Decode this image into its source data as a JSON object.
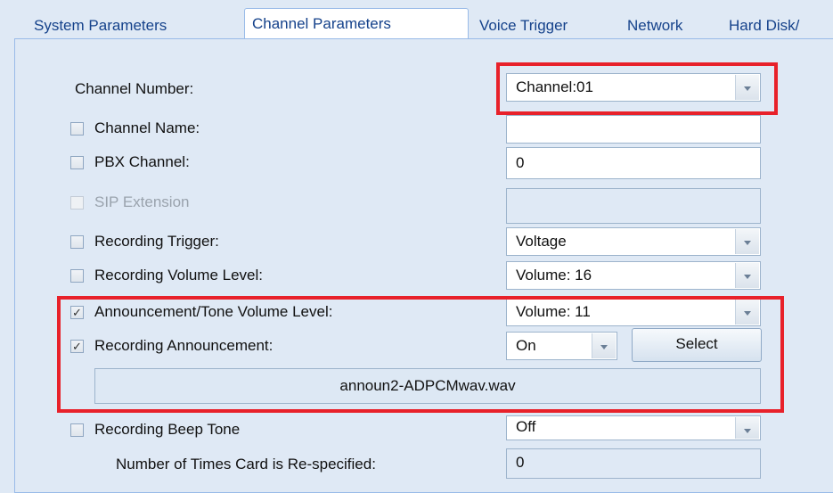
{
  "tabs": [
    {
      "label": "System Parameters"
    },
    {
      "label": "Channel Parameters"
    },
    {
      "label": "Voice Trigger"
    },
    {
      "label": "Network"
    },
    {
      "label": "Hard Disk/"
    }
  ],
  "form": {
    "channel_number": {
      "label": "Channel Number:",
      "value": "Channel:01"
    },
    "channel_name": {
      "label": "Channel Name:",
      "value": "",
      "checked": false
    },
    "pbx_channel": {
      "label": "PBX Channel:",
      "value": "0",
      "checked": false
    },
    "sip_extension": {
      "label": "SIP Extension",
      "value": "",
      "checked": false,
      "disabled": true
    },
    "recording_trigger": {
      "label": "Recording Trigger:",
      "value": "Voltage",
      "checked": false
    },
    "recording_volume": {
      "label": "Recording Volume Level:",
      "value": "Volume: 16",
      "checked": false
    },
    "announcement_volume": {
      "label": "Announcement/Tone Volume Level:",
      "value": "Volume: 11",
      "checked": true
    },
    "recording_announcement": {
      "label": "Recording Announcement:",
      "value": "On",
      "checked": true,
      "select_button": "Select",
      "file": "announ2-ADPCMwav.wav"
    },
    "recording_beep": {
      "label": "Recording Beep Tone",
      "value": "Off",
      "checked": false
    },
    "card_respecified": {
      "label": "Number of Times Card is Re-specified:",
      "value": "0"
    }
  },
  "colors": {
    "highlight": "#e8212a",
    "tab_text": "#15428b",
    "panel_bg": "#dfe9f5"
  }
}
